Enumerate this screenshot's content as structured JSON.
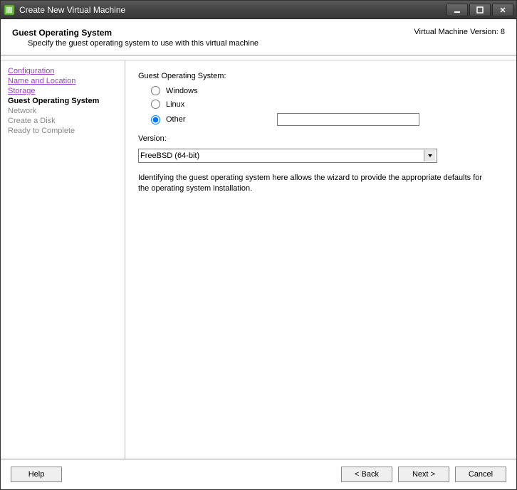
{
  "titlebar": {
    "title": "Create New Virtual Machine"
  },
  "header": {
    "title": "Guest Operating System",
    "subtitle": "Specify the guest operating system to use with this virtual machine",
    "version": "Virtual Machine Version: 8"
  },
  "sidebar": {
    "items": [
      {
        "label": "Configuration",
        "type": "link"
      },
      {
        "label": "Name and Location",
        "type": "link"
      },
      {
        "label": "Storage",
        "type": "link"
      },
      {
        "label": "Guest Operating System",
        "type": "current"
      },
      {
        "label": "Network",
        "type": "disabled"
      },
      {
        "label": "Create a Disk",
        "type": "disabled"
      },
      {
        "label": "Ready to Complete",
        "type": "disabled"
      }
    ]
  },
  "main": {
    "group_label": "Guest Operating System:",
    "radios": {
      "windows": "Windows",
      "linux": "Linux",
      "other": "Other"
    },
    "selected_radio": "other",
    "other_value": "",
    "version_label": "Version:",
    "version_value": "FreeBSD (64-bit)",
    "info_text": "Identifying the guest operating system here allows the wizard to provide the appropriate defaults for the operating system installation."
  },
  "footer": {
    "help": "Help",
    "back": "< Back",
    "next": "Next >",
    "cancel": "Cancel"
  }
}
